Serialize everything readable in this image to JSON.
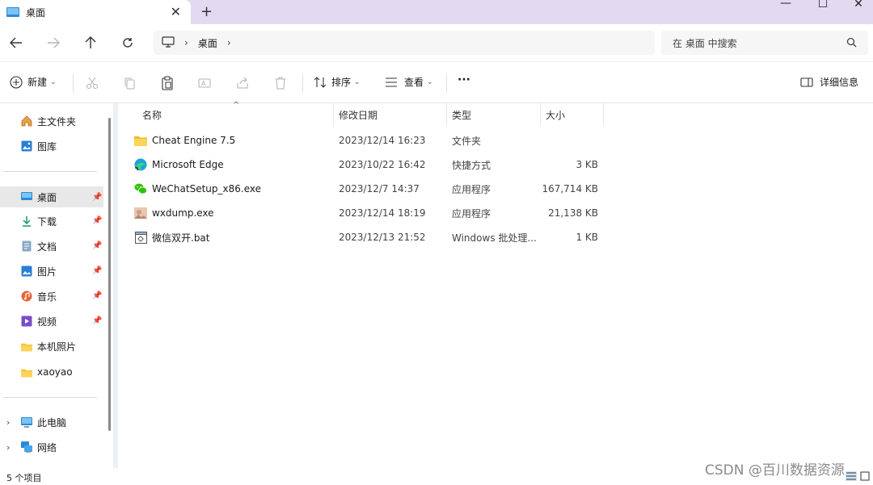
{
  "window": {
    "tab_title": "桌面",
    "tab_close": "✕",
    "new_tab": "+",
    "minimize": "—",
    "maximize": "☐",
    "close": "✕"
  },
  "address": {
    "breadcrumb": [
      "桌面"
    ],
    "search_placeholder": "在 桌面 中搜索"
  },
  "toolbar": {
    "new_label": "新建",
    "sort_label": "排序",
    "view_label": "查看",
    "more_label": "···",
    "details_label": "详细信息",
    "icons": [
      "cut-icon",
      "copy-icon",
      "paste-icon",
      "rename-icon",
      "share-icon",
      "delete-icon"
    ]
  },
  "sidebar": {
    "top": [
      {
        "label": "主文件夹",
        "icon": "home-icon"
      },
      {
        "label": "图库",
        "icon": "gallery-icon"
      }
    ],
    "pinned": [
      {
        "label": "桌面",
        "icon": "desktop-icon",
        "selected": true
      },
      {
        "label": "下载",
        "icon": "download-icon"
      },
      {
        "label": "文档",
        "icon": "document-icon"
      },
      {
        "label": "图片",
        "icon": "picture-icon"
      },
      {
        "label": "音乐",
        "icon": "music-icon"
      },
      {
        "label": "视频",
        "icon": "video-icon"
      }
    ],
    "folders": [
      {
        "label": "本机照片",
        "icon": "folder-icon"
      },
      {
        "label": "xaoyao",
        "icon": "folder-icon"
      }
    ],
    "bottom": [
      {
        "label": "此电脑",
        "icon": "computer-icon"
      },
      {
        "label": "网络",
        "icon": "network-icon"
      }
    ]
  },
  "columns": {
    "name": "名称",
    "date": "修改日期",
    "type": "类型",
    "size": "大小"
  },
  "files": [
    {
      "name": "Cheat Engine 7.5",
      "date": "2023/12/14 16:23",
      "type": "文件夹",
      "size": "",
      "icon": "folder-icon"
    },
    {
      "name": "Microsoft Edge",
      "date": "2023/10/22 16:42",
      "type": "快捷方式",
      "size": "3 KB",
      "icon": "edge-icon"
    },
    {
      "name": "WeChatSetup_x86.exe",
      "date": "2023/12/7 14:37",
      "type": "应用程序",
      "size": "167,714 KB",
      "icon": "wechat-icon"
    },
    {
      "name": "wxdump.exe",
      "date": "2023/12/14 18:19",
      "type": "应用程序",
      "size": "21,138 KB",
      "icon": "app-icon"
    },
    {
      "name": "微信双开.bat",
      "date": "2023/12/13 21:52",
      "type": "Windows 批处理...",
      "size": "1 KB",
      "icon": "batch-file-icon"
    }
  ],
  "status": {
    "item_count": "5 个项目"
  },
  "watermark": "CSDN @百川数据资源",
  "colors": {
    "titlebar": "#e3d9f0",
    "folder": "#f7c23c",
    "accent": "#0067c0"
  }
}
